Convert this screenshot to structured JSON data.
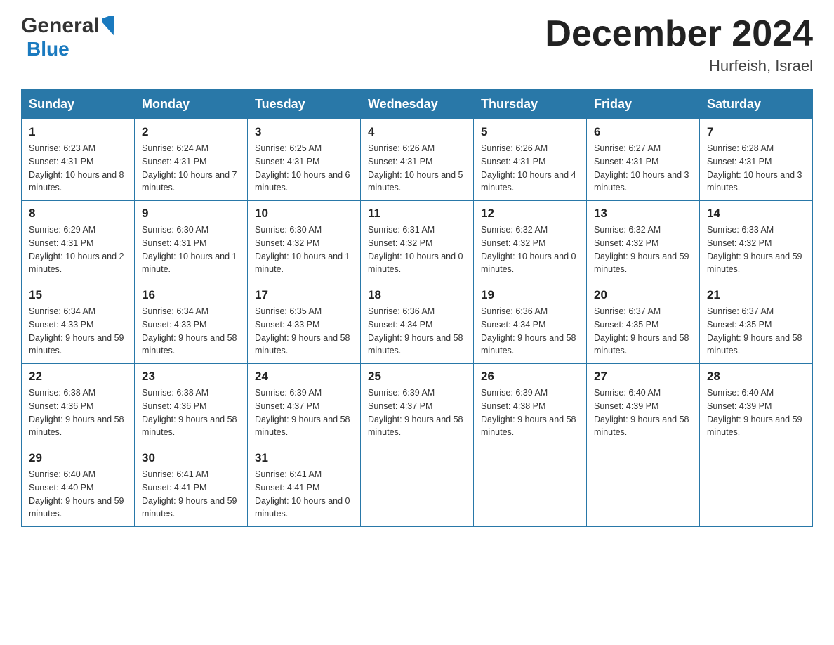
{
  "header": {
    "logo_general": "General",
    "logo_blue": "Blue",
    "month_title": "December 2024",
    "location": "Hurfeish, Israel"
  },
  "weekdays": [
    "Sunday",
    "Monday",
    "Tuesday",
    "Wednesday",
    "Thursday",
    "Friday",
    "Saturday"
  ],
  "weeks": [
    [
      {
        "day": "1",
        "sunrise": "6:23 AM",
        "sunset": "4:31 PM",
        "daylight": "10 hours and 8 minutes."
      },
      {
        "day": "2",
        "sunrise": "6:24 AM",
        "sunset": "4:31 PM",
        "daylight": "10 hours and 7 minutes."
      },
      {
        "day": "3",
        "sunrise": "6:25 AM",
        "sunset": "4:31 PM",
        "daylight": "10 hours and 6 minutes."
      },
      {
        "day": "4",
        "sunrise": "6:26 AM",
        "sunset": "4:31 PM",
        "daylight": "10 hours and 5 minutes."
      },
      {
        "day": "5",
        "sunrise": "6:26 AM",
        "sunset": "4:31 PM",
        "daylight": "10 hours and 4 minutes."
      },
      {
        "day": "6",
        "sunrise": "6:27 AM",
        "sunset": "4:31 PM",
        "daylight": "10 hours and 3 minutes."
      },
      {
        "day": "7",
        "sunrise": "6:28 AM",
        "sunset": "4:31 PM",
        "daylight": "10 hours and 3 minutes."
      }
    ],
    [
      {
        "day": "8",
        "sunrise": "6:29 AM",
        "sunset": "4:31 PM",
        "daylight": "10 hours and 2 minutes."
      },
      {
        "day": "9",
        "sunrise": "6:30 AM",
        "sunset": "4:31 PM",
        "daylight": "10 hours and 1 minute."
      },
      {
        "day": "10",
        "sunrise": "6:30 AM",
        "sunset": "4:32 PM",
        "daylight": "10 hours and 1 minute."
      },
      {
        "day": "11",
        "sunrise": "6:31 AM",
        "sunset": "4:32 PM",
        "daylight": "10 hours and 0 minutes."
      },
      {
        "day": "12",
        "sunrise": "6:32 AM",
        "sunset": "4:32 PM",
        "daylight": "10 hours and 0 minutes."
      },
      {
        "day": "13",
        "sunrise": "6:32 AM",
        "sunset": "4:32 PM",
        "daylight": "9 hours and 59 minutes."
      },
      {
        "day": "14",
        "sunrise": "6:33 AM",
        "sunset": "4:32 PM",
        "daylight": "9 hours and 59 minutes."
      }
    ],
    [
      {
        "day": "15",
        "sunrise": "6:34 AM",
        "sunset": "4:33 PM",
        "daylight": "9 hours and 59 minutes."
      },
      {
        "day": "16",
        "sunrise": "6:34 AM",
        "sunset": "4:33 PM",
        "daylight": "9 hours and 58 minutes."
      },
      {
        "day": "17",
        "sunrise": "6:35 AM",
        "sunset": "4:33 PM",
        "daylight": "9 hours and 58 minutes."
      },
      {
        "day": "18",
        "sunrise": "6:36 AM",
        "sunset": "4:34 PM",
        "daylight": "9 hours and 58 minutes."
      },
      {
        "day": "19",
        "sunrise": "6:36 AM",
        "sunset": "4:34 PM",
        "daylight": "9 hours and 58 minutes."
      },
      {
        "day": "20",
        "sunrise": "6:37 AM",
        "sunset": "4:35 PM",
        "daylight": "9 hours and 58 minutes."
      },
      {
        "day": "21",
        "sunrise": "6:37 AM",
        "sunset": "4:35 PM",
        "daylight": "9 hours and 58 minutes."
      }
    ],
    [
      {
        "day": "22",
        "sunrise": "6:38 AM",
        "sunset": "4:36 PM",
        "daylight": "9 hours and 58 minutes."
      },
      {
        "day": "23",
        "sunrise": "6:38 AM",
        "sunset": "4:36 PM",
        "daylight": "9 hours and 58 minutes."
      },
      {
        "day": "24",
        "sunrise": "6:39 AM",
        "sunset": "4:37 PM",
        "daylight": "9 hours and 58 minutes."
      },
      {
        "day": "25",
        "sunrise": "6:39 AM",
        "sunset": "4:37 PM",
        "daylight": "9 hours and 58 minutes."
      },
      {
        "day": "26",
        "sunrise": "6:39 AM",
        "sunset": "4:38 PM",
        "daylight": "9 hours and 58 minutes."
      },
      {
        "day": "27",
        "sunrise": "6:40 AM",
        "sunset": "4:39 PM",
        "daylight": "9 hours and 58 minutes."
      },
      {
        "day": "28",
        "sunrise": "6:40 AM",
        "sunset": "4:39 PM",
        "daylight": "9 hours and 59 minutes."
      }
    ],
    [
      {
        "day": "29",
        "sunrise": "6:40 AM",
        "sunset": "4:40 PM",
        "daylight": "9 hours and 59 minutes."
      },
      {
        "day": "30",
        "sunrise": "6:41 AM",
        "sunset": "4:41 PM",
        "daylight": "9 hours and 59 minutes."
      },
      {
        "day": "31",
        "sunrise": "6:41 AM",
        "sunset": "4:41 PM",
        "daylight": "10 hours and 0 minutes."
      },
      null,
      null,
      null,
      null
    ]
  ]
}
